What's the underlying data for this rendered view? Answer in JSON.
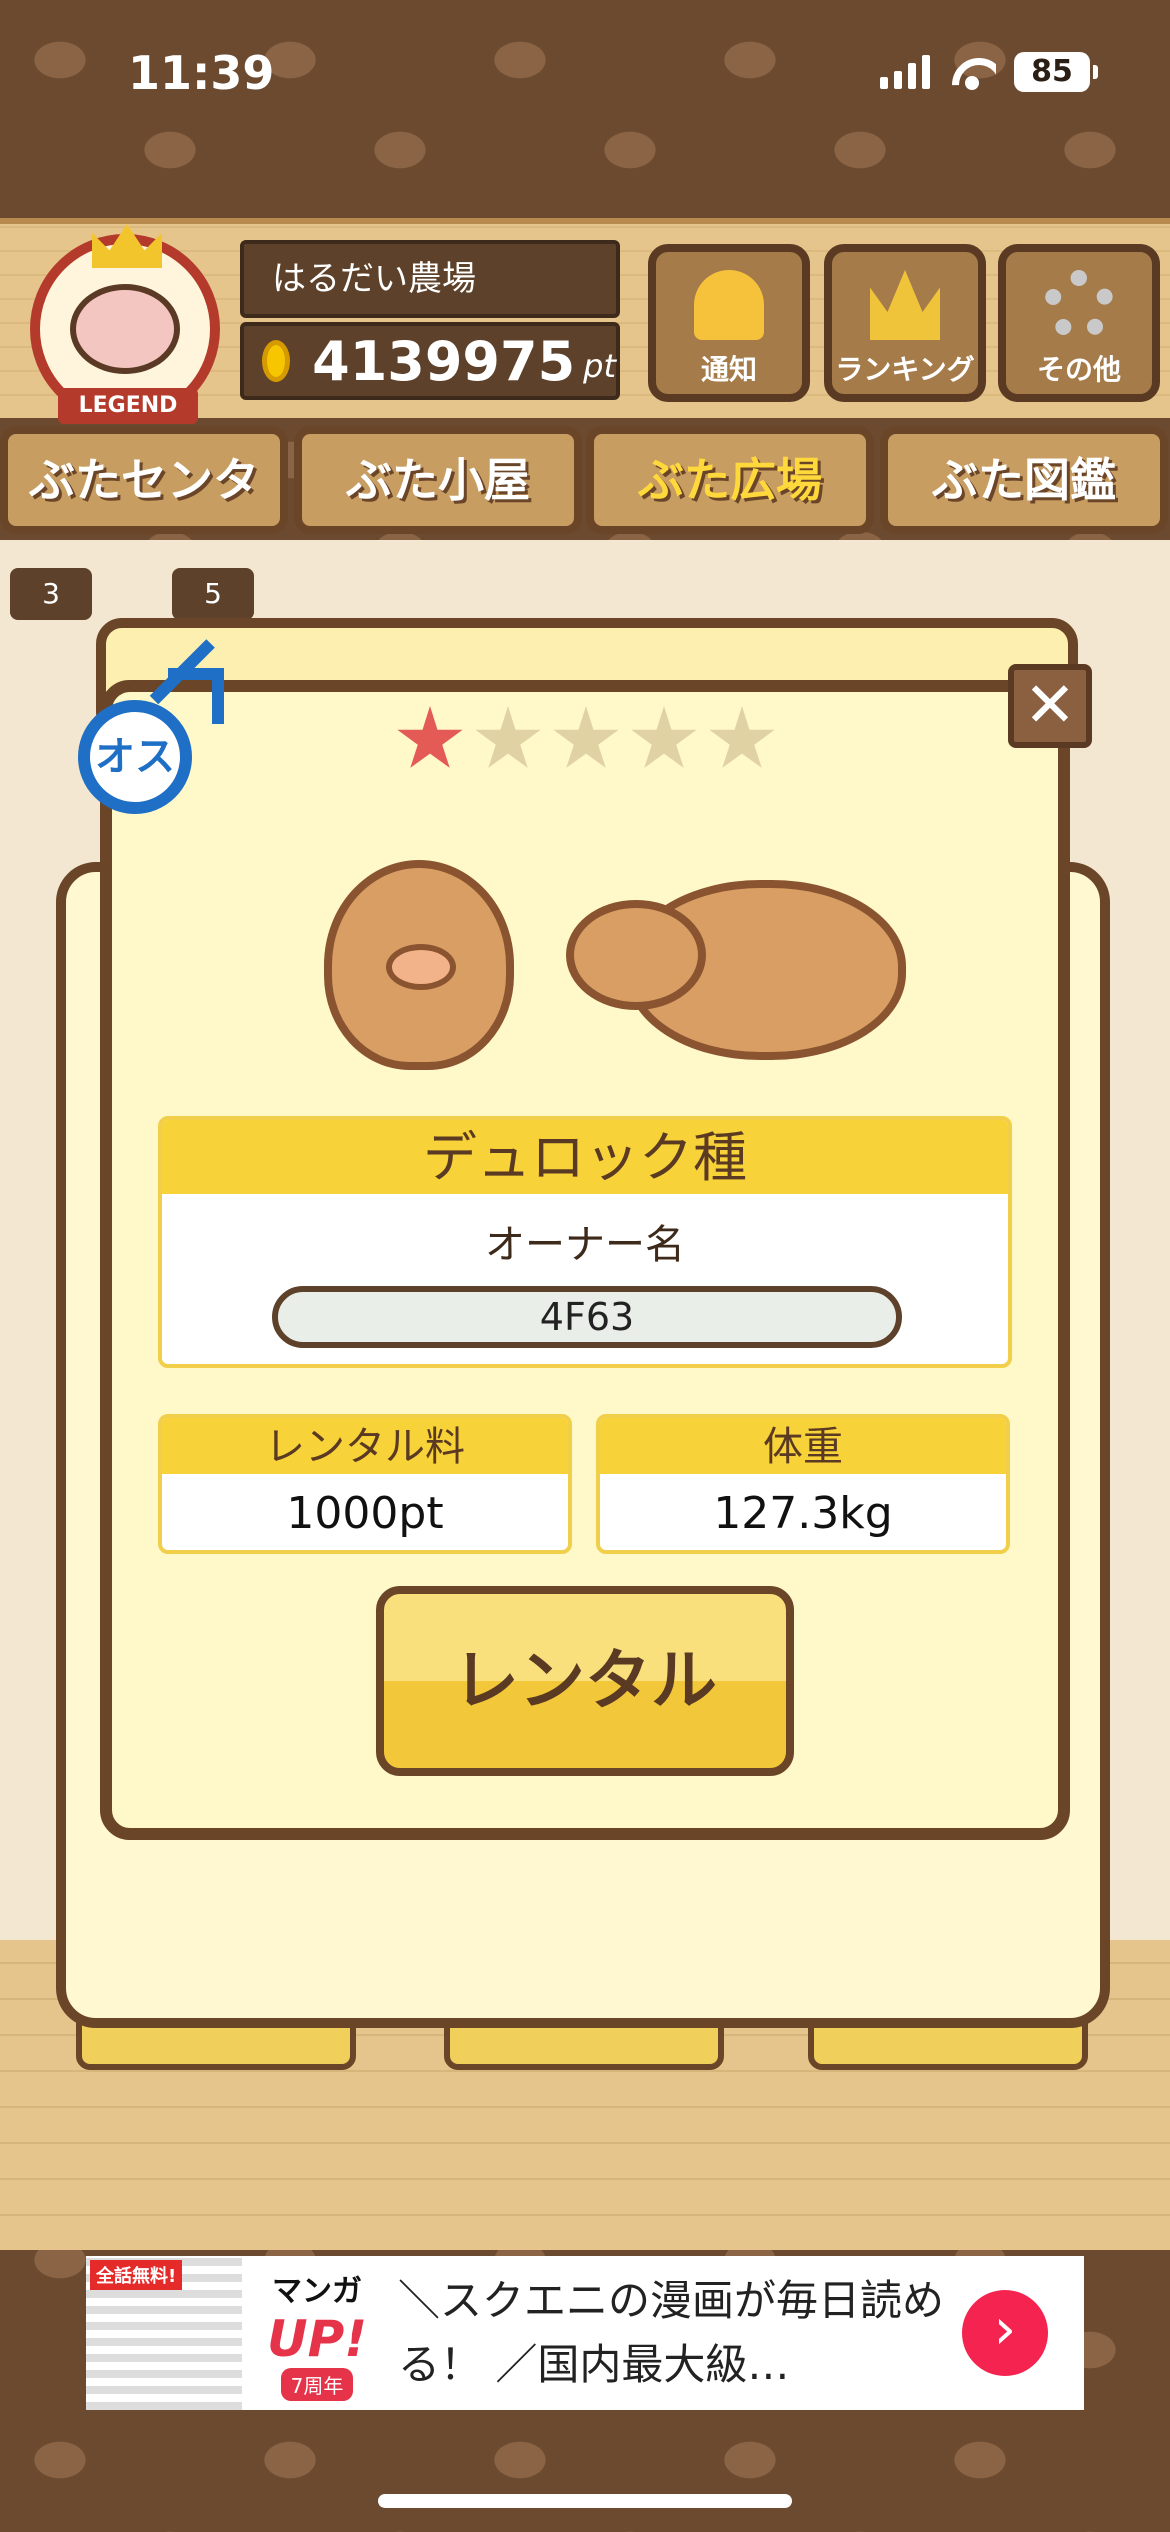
{
  "status": {
    "time": "11:39",
    "battery": "85"
  },
  "header": {
    "farm_name": "はるだい農場",
    "points": "4139975",
    "points_unit": "pt",
    "rank_label": "LEGEND",
    "buttons": [
      {
        "label": "通知",
        "icon": "bell-icon"
      },
      {
        "label": "ランキング",
        "icon": "crown-icon"
      },
      {
        "label": "その他",
        "icon": "gear-icon"
      }
    ]
  },
  "nav": {
    "tabs": [
      {
        "label": "ぶたセンター"
      },
      {
        "label": "ぶた小屋"
      },
      {
        "label": "ぶた広場",
        "active": true
      },
      {
        "label": "ぶた図鑑"
      }
    ]
  },
  "background": {
    "counters": [
      "3",
      "5"
    ]
  },
  "modal": {
    "gender_label": "オス",
    "rating": 1,
    "rating_max": 5,
    "breed": "デュロック種",
    "owner_label": "オーナー名",
    "owner_name": "4F63",
    "rental_fee_label": "レンタル料",
    "rental_fee_value": "1000pt",
    "weight_label": "体重",
    "weight_value": "127.3kg",
    "rental_button": "レンタル",
    "close_symbol": "✕"
  },
  "ad": {
    "thumb_tag": "全話無料!",
    "logo_top": "マンガ",
    "logo_main": "UP!",
    "logo_sub": "7周年",
    "text": "＼スクエニの漫画が毎日読める！ ／国内最大級…",
    "arrow": "›"
  },
  "colors": {
    "wood_dark": "#6a4528",
    "accent_yellow": "#f8d239",
    "star_filled": "#e45a55",
    "male_blue": "#1e6fc5",
    "ad_cta": "#f5234f"
  }
}
